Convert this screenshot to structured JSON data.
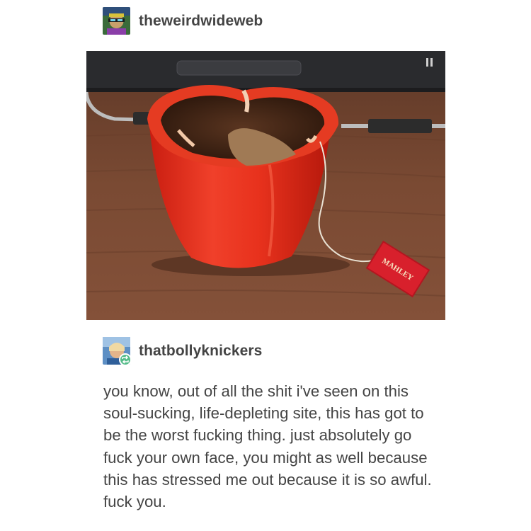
{
  "original_post": {
    "username": "theweirdwideweb",
    "avatar_icon": "user-avatar-icon"
  },
  "photo": {
    "tag_text": "MAHLEY",
    "colors": {
      "pepper": "#e8321d",
      "tea": "#4a2c1a",
      "table": "#7a4a33",
      "laptop": "#2a2b2e"
    }
  },
  "reblog": {
    "username": "thatbollyknickers",
    "avatar_icon": "user-avatar-icon",
    "badge_icon": "reblog-icon",
    "badge_color": "#56bc8a",
    "comment": "you know, out of all the shit i've seen on this soul-sucking, life-depleting site, this has got to be the worst fucking thing. just absolutely go fuck your own face, you might as well because this has stressed me out because it is so awful. fuck you."
  }
}
